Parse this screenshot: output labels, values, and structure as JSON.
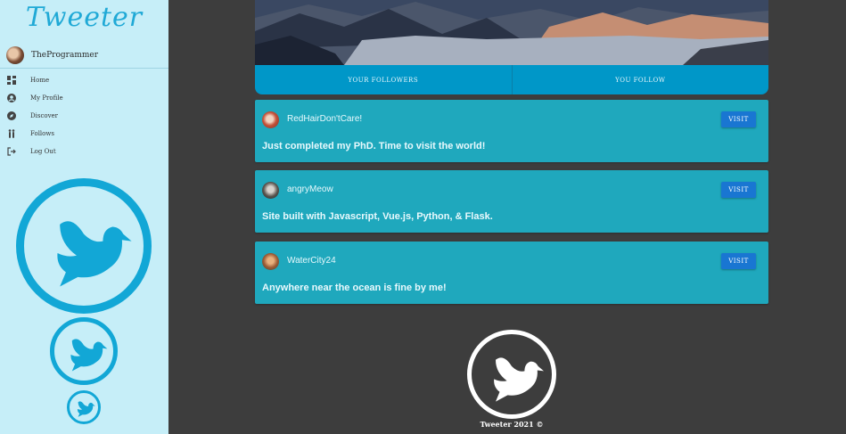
{
  "brand": {
    "title": "Tweeter"
  },
  "user": {
    "name": "TheProgrammer"
  },
  "nav": {
    "items": [
      {
        "label": "Home",
        "icon": "dashboard-icon"
      },
      {
        "label": "My Profile",
        "icon": "account-circle-icon"
      },
      {
        "label": "Discover",
        "icon": "compass-icon"
      },
      {
        "label": "Follows",
        "icon": "people-icon"
      },
      {
        "label": "Log Out",
        "icon": "logout-icon"
      }
    ]
  },
  "tabs": {
    "followers": "YOUR FOLLOWERS",
    "following": "YOU FOLLOW"
  },
  "posts": [
    {
      "user": "RedHairDon'tCare!",
      "text": "Just completed my PhD. Time to visit the world!",
      "visit": "VISIT"
    },
    {
      "user": "angryMeow",
      "text": "Site built with Javascript, Vue.js, Python, & Flask.",
      "visit": "VISIT"
    },
    {
      "user": "WaterCity24",
      "text": "Anywhere near the ocean is fine by me!",
      "visit": "VISIT"
    }
  ],
  "footer": {
    "text": "Tweeter 2021 ©"
  },
  "colors": {
    "sidebar_bg": "#c6eef8",
    "main_bg": "#3d3d3d",
    "accent": "#12a7d6",
    "tab_bar": "#0097c8",
    "post_card": "#1fa8bd",
    "button": "#1976d2"
  }
}
